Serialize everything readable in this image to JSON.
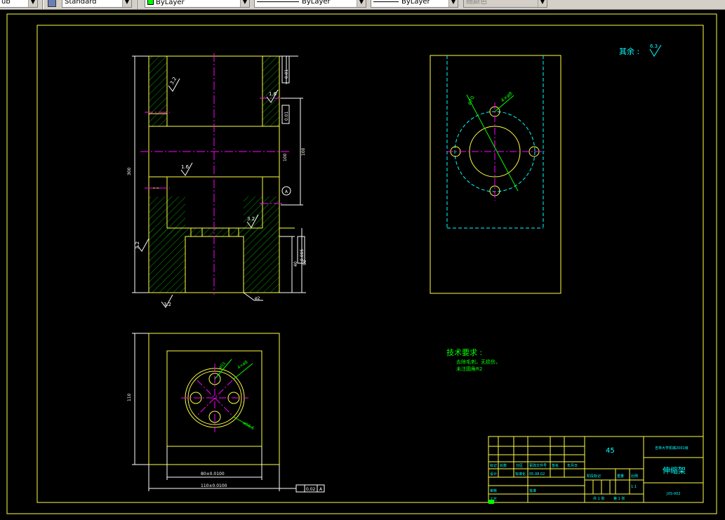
{
  "toolbar": {
    "textstyle_value": "ub",
    "dimstyle_value": "Standard",
    "layer_value": "ByLayer",
    "linetype_value": "ByLayer",
    "lineweight_value": "ByLayer",
    "plotstyle_value": "随颜色"
  },
  "drawing": {
    "note_rest": "其余 :",
    "note_rest_roughness": "6.3",
    "tech_title": "技术要求 :",
    "tech_line1": "去除毛刺，无损伤，",
    "tech_line2": "未注圆角R2",
    "roughness_values": [
      "3.2",
      "1.6",
      "1.6",
      "3.2",
      "3.2",
      "3.2"
    ],
    "dims_front": {
      "overall_height": "300",
      "height_90": "90",
      "height_40": "40",
      "right_tol1": "0.01",
      "right_tol2": "0.01",
      "right_tol3": "0.005",
      "mid_dim": "100",
      "mid_dim2": "100",
      "bottom_label": "ø2"
    },
    "dims_side": {
      "bolt_circle": "ø70",
      "hole": "4×ø8"
    },
    "dims_top": {
      "width_inner": "80±0.0100",
      "width_outer": "110±0.0100",
      "height_side": "110",
      "flatness": "0.02",
      "datum": "A",
      "bolt_circle": "ø55",
      "hole": "4×ø8",
      "bolt_circle2": "ø56.5"
    }
  },
  "title_block": {
    "material": "45",
    "part_name": "伸缩架",
    "school": "吉林大学机械2001级",
    "drawing_no": "JXS-002",
    "scale": "1:1",
    "sheet_total": "共 1 张",
    "sheet_no": "第 1 张",
    "col_mark": "标记",
    "col_count": "处数",
    "col_zone": "分区",
    "col_doc": "更改文件号",
    "col_sign": "签名",
    "col_date": "年月日",
    "row_design": "设计",
    "row_std": "标准化",
    "row_design_date": "05.08.02",
    "row_review": "审核",
    "row_process": "工艺",
    "row_approve": "批准",
    "stage_label": "阶段标记",
    "weight_label": "重量",
    "scale_label": "比例"
  }
}
